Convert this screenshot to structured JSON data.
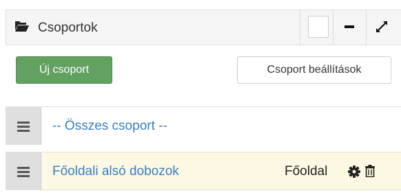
{
  "header": {
    "title": "Csoportok",
    "icons": {
      "title": "folder-open-icon",
      "select": "checkbox",
      "minimize": "minus-icon",
      "expand": "expand-icon"
    }
  },
  "toolbar": {
    "new_group_label": "Új csoport",
    "settings_label": "Csoport beállítások"
  },
  "groups": [
    {
      "label": "-- Összes csoport --",
      "page": "",
      "highlighted": false
    },
    {
      "label": "Főoldali alsó dobozok",
      "page": "Főoldal",
      "highlighted": true,
      "actions": [
        "gear-icon",
        "trash-icon"
      ]
    }
  ],
  "colors": {
    "primary_button": "#62a162",
    "link": "#3a7fc1",
    "highlight_row": "#fcf8e3"
  }
}
